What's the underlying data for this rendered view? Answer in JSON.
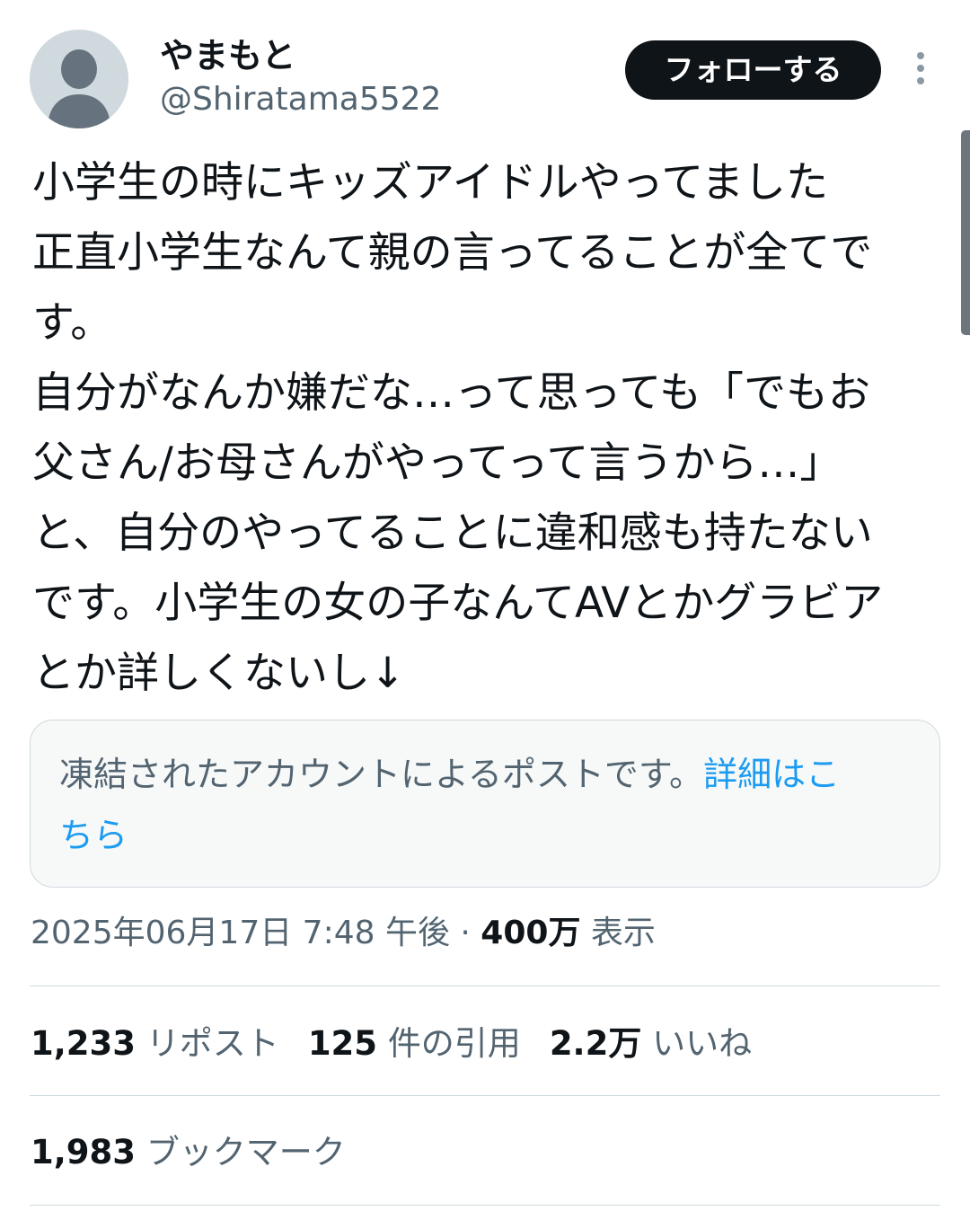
{
  "author": {
    "display_name": "やまもと",
    "handle": "@Shiratama5522"
  },
  "follow_button_label": "フォローする",
  "tweet": {
    "lines": [
      "小学生の時にキッズアイドルやってました",
      "正直小学生なんて親の言ってることが全てで",
      "す。",
      "自分がなんか嫌だな…って思っても「でもお",
      "父さん/お母さんがやってって言うから…」",
      "と、自分のやってることに違和感も持たない",
      "です。小学生の女の子なんてAVとかグラビア",
      "とか詳しくないし↓"
    ]
  },
  "notice": {
    "line1_text": "凍結されたアカウントによるポストです。",
    "line1_link": "詳細はこ",
    "line2_link": "ちら"
  },
  "meta": {
    "date": "2025年06月17日 7:48 午後 · ",
    "views_count": "400万",
    "views_label": "表示"
  },
  "stats": {
    "reposts_count": "1,233",
    "reposts_label": "リポスト",
    "quotes_count": "125",
    "quotes_label": "件の引用",
    "likes_count": "2.2万",
    "likes_label": "いいね",
    "bookmarks_count": "1,983",
    "bookmarks_label": "ブックマーク"
  }
}
